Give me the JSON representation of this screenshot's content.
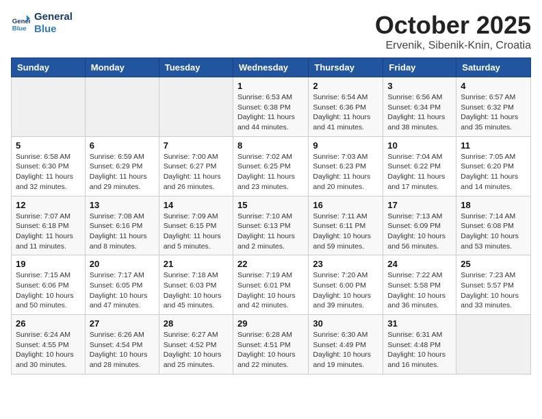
{
  "header": {
    "logo_line1": "General",
    "logo_line2": "Blue",
    "month": "October 2025",
    "location": "Ervenik, Sibenik-Knin, Croatia"
  },
  "weekdays": [
    "Sunday",
    "Monday",
    "Tuesday",
    "Wednesday",
    "Thursday",
    "Friday",
    "Saturday"
  ],
  "weeks": [
    [
      {
        "day": "",
        "info": ""
      },
      {
        "day": "",
        "info": ""
      },
      {
        "day": "",
        "info": ""
      },
      {
        "day": "1",
        "info": "Sunrise: 6:53 AM\nSunset: 6:38 PM\nDaylight: 11 hours\nand 44 minutes."
      },
      {
        "day": "2",
        "info": "Sunrise: 6:54 AM\nSunset: 6:36 PM\nDaylight: 11 hours\nand 41 minutes."
      },
      {
        "day": "3",
        "info": "Sunrise: 6:56 AM\nSunset: 6:34 PM\nDaylight: 11 hours\nand 38 minutes."
      },
      {
        "day": "4",
        "info": "Sunrise: 6:57 AM\nSunset: 6:32 PM\nDaylight: 11 hours\nand 35 minutes."
      }
    ],
    [
      {
        "day": "5",
        "info": "Sunrise: 6:58 AM\nSunset: 6:30 PM\nDaylight: 11 hours\nand 32 minutes."
      },
      {
        "day": "6",
        "info": "Sunrise: 6:59 AM\nSunset: 6:29 PM\nDaylight: 11 hours\nand 29 minutes."
      },
      {
        "day": "7",
        "info": "Sunrise: 7:00 AM\nSunset: 6:27 PM\nDaylight: 11 hours\nand 26 minutes."
      },
      {
        "day": "8",
        "info": "Sunrise: 7:02 AM\nSunset: 6:25 PM\nDaylight: 11 hours\nand 23 minutes."
      },
      {
        "day": "9",
        "info": "Sunrise: 7:03 AM\nSunset: 6:23 PM\nDaylight: 11 hours\nand 20 minutes."
      },
      {
        "day": "10",
        "info": "Sunrise: 7:04 AM\nSunset: 6:22 PM\nDaylight: 11 hours\nand 17 minutes."
      },
      {
        "day": "11",
        "info": "Sunrise: 7:05 AM\nSunset: 6:20 PM\nDaylight: 11 hours\nand 14 minutes."
      }
    ],
    [
      {
        "day": "12",
        "info": "Sunrise: 7:07 AM\nSunset: 6:18 PM\nDaylight: 11 hours\nand 11 minutes."
      },
      {
        "day": "13",
        "info": "Sunrise: 7:08 AM\nSunset: 6:16 PM\nDaylight: 11 hours\nand 8 minutes."
      },
      {
        "day": "14",
        "info": "Sunrise: 7:09 AM\nSunset: 6:15 PM\nDaylight: 11 hours\nand 5 minutes."
      },
      {
        "day": "15",
        "info": "Sunrise: 7:10 AM\nSunset: 6:13 PM\nDaylight: 11 hours\nand 2 minutes."
      },
      {
        "day": "16",
        "info": "Sunrise: 7:11 AM\nSunset: 6:11 PM\nDaylight: 10 hours\nand 59 minutes."
      },
      {
        "day": "17",
        "info": "Sunrise: 7:13 AM\nSunset: 6:09 PM\nDaylight: 10 hours\nand 56 minutes."
      },
      {
        "day": "18",
        "info": "Sunrise: 7:14 AM\nSunset: 6:08 PM\nDaylight: 10 hours\nand 53 minutes."
      }
    ],
    [
      {
        "day": "19",
        "info": "Sunrise: 7:15 AM\nSunset: 6:06 PM\nDaylight: 10 hours\nand 50 minutes."
      },
      {
        "day": "20",
        "info": "Sunrise: 7:17 AM\nSunset: 6:05 PM\nDaylight: 10 hours\nand 47 minutes."
      },
      {
        "day": "21",
        "info": "Sunrise: 7:18 AM\nSunset: 6:03 PM\nDaylight: 10 hours\nand 45 minutes."
      },
      {
        "day": "22",
        "info": "Sunrise: 7:19 AM\nSunset: 6:01 PM\nDaylight: 10 hours\nand 42 minutes."
      },
      {
        "day": "23",
        "info": "Sunrise: 7:20 AM\nSunset: 6:00 PM\nDaylight: 10 hours\nand 39 minutes."
      },
      {
        "day": "24",
        "info": "Sunrise: 7:22 AM\nSunset: 5:58 PM\nDaylight: 10 hours\nand 36 minutes."
      },
      {
        "day": "25",
        "info": "Sunrise: 7:23 AM\nSunset: 5:57 PM\nDaylight: 10 hours\nand 33 minutes."
      }
    ],
    [
      {
        "day": "26",
        "info": "Sunrise: 6:24 AM\nSunset: 4:55 PM\nDaylight: 10 hours\nand 30 minutes."
      },
      {
        "day": "27",
        "info": "Sunrise: 6:26 AM\nSunset: 4:54 PM\nDaylight: 10 hours\nand 28 minutes."
      },
      {
        "day": "28",
        "info": "Sunrise: 6:27 AM\nSunset: 4:52 PM\nDaylight: 10 hours\nand 25 minutes."
      },
      {
        "day": "29",
        "info": "Sunrise: 6:28 AM\nSunset: 4:51 PM\nDaylight: 10 hours\nand 22 minutes."
      },
      {
        "day": "30",
        "info": "Sunrise: 6:30 AM\nSunset: 4:49 PM\nDaylight: 10 hours\nand 19 minutes."
      },
      {
        "day": "31",
        "info": "Sunrise: 6:31 AM\nSunset: 4:48 PM\nDaylight: 10 hours\nand 16 minutes."
      },
      {
        "day": "",
        "info": ""
      }
    ]
  ]
}
